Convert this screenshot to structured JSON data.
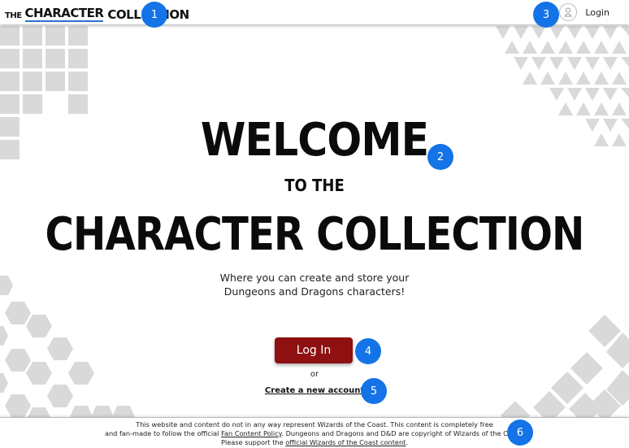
{
  "header": {
    "brand_the": "THE",
    "brand_character": "CHARACTER",
    "brand_collection": "COLLECTION",
    "login_label": "Login",
    "avatar_icon": "user-avatar-icon"
  },
  "hero": {
    "welcome": "WELCOME",
    "to_the": "TO THE",
    "collection_title": "CHARACTER COLLECTION",
    "tagline_line1": "Where you can create and store your",
    "tagline_line2": "Dungeons and Dragons characters!"
  },
  "actions": {
    "login_button": "Log In",
    "or_text": "or",
    "create_account": "Create a new account"
  },
  "footer": {
    "line1": "This website and content do not in any way represent Wizards of the Coast. This content is completely free",
    "line2_a": "and fan-made to follow the official ",
    "fan_content_policy": "Fan Content Policy",
    "line2_b": ". Dungeons and Dragons and D&D are copyright of Wizards of the Coast.",
    "line3_a": "Please support the ",
    "wotc_link": "official Wizards of the Coast content",
    "line3_b": "."
  },
  "markers": [
    "1",
    "2",
    "3",
    "4",
    "5",
    "6"
  ],
  "colors": {
    "button": "#8e1010",
    "brand_underline": "#2f6fd0",
    "marker": "#1473e6",
    "deco": "#d9d9d9"
  }
}
